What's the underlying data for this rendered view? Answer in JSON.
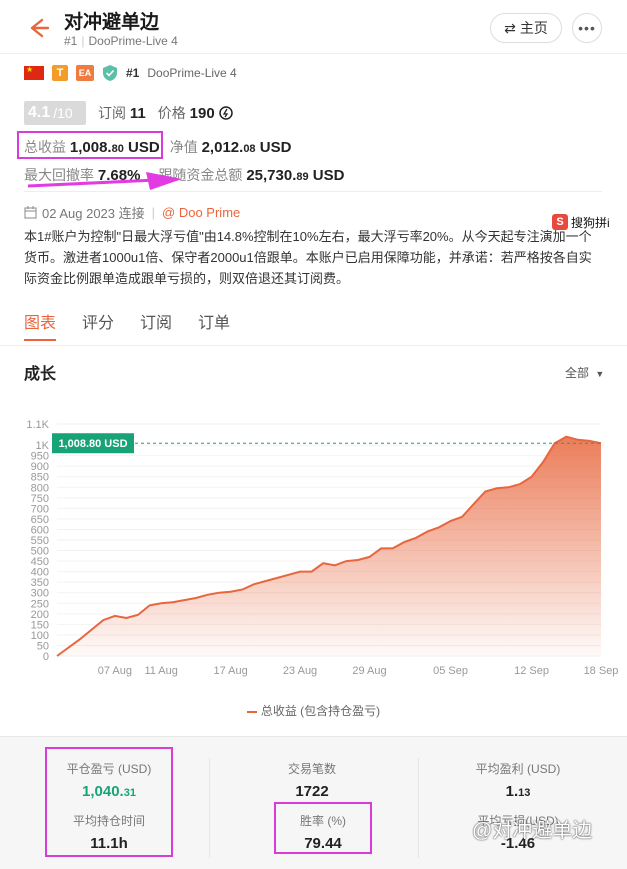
{
  "header": {
    "title": "对冲避单边",
    "rank": "#1",
    "server": "DooPrime-Live 4",
    "home_label": "主页"
  },
  "badges": {
    "t_label": "T",
    "ea_label": "EA",
    "rank": "#1",
    "server": "DooPrime-Live 4"
  },
  "rating": {
    "score": "4.1",
    "max": "/10",
    "subscribe_label": "订阅",
    "subscribe_value": "11",
    "price_label": "价格",
    "price_value": "190"
  },
  "stats": {
    "total_profit_label": "总收益",
    "total_profit_main": "1,008.",
    "total_profit_dec": "80",
    "total_profit_unit": "USD",
    "equity_label": "净值",
    "equity_main": "2,012.",
    "equity_dec": "08",
    "equity_unit": "USD",
    "drawdown_label": "最大回撤率",
    "drawdown_value": "7.68%",
    "follow_label": "跟随资金总额",
    "follow_main": "25,730.",
    "follow_dec": "89",
    "follow_unit": "USD"
  },
  "connection": {
    "date": "02 Aug 2023 连接",
    "broker": "@ Doo Prime"
  },
  "description": "本1#账户为控制\"日最大浮亏值\"由14.8%控制在10%左右，最大浮亏率20%。从今天起专注演加一个货币。激进者1000u1倍、保守者2000u1倍跟单。本账户已启用保障功能，并承诺：若严格按各自实际资金比例跟单造成跟单亏损的，则双倍退还其订阅费。",
  "sogou_label": "搜狗拼i",
  "tabs": [
    "图表",
    "评分",
    "订阅",
    "订单"
  ],
  "chart_section": {
    "title": "成长",
    "range": "全部"
  },
  "chart_data": {
    "type": "area",
    "title": "",
    "series": [
      {
        "name": "总收益 (包含持仓盈亏)",
        "x": [
          "2023-08-02",
          "2023-08-04",
          "2023-08-06",
          "2023-08-07",
          "2023-08-08",
          "2023-08-09",
          "2023-08-10",
          "2023-08-11",
          "2023-08-12",
          "2023-08-13",
          "2023-08-14",
          "2023-08-15",
          "2023-08-16",
          "2023-08-17",
          "2023-08-18",
          "2023-08-19",
          "2023-08-20",
          "2023-08-21",
          "2023-08-22",
          "2023-08-23",
          "2023-08-24",
          "2023-08-25",
          "2023-08-26",
          "2023-08-27",
          "2023-08-28",
          "2023-08-29",
          "2023-08-30",
          "2023-08-31",
          "2023-09-01",
          "2023-09-02",
          "2023-09-03",
          "2023-09-04",
          "2023-09-05",
          "2023-09-06",
          "2023-09-07",
          "2023-09-08",
          "2023-09-09",
          "2023-09-10",
          "2023-09-11",
          "2023-09-12",
          "2023-09-13",
          "2023-09-14",
          "2023-09-15",
          "2023-09-16",
          "2023-09-17",
          "2023-09-18"
        ],
        "values": [
          0,
          80,
          170,
          190,
          180,
          195,
          240,
          250,
          255,
          265,
          275,
          290,
          300,
          305,
          315,
          340,
          355,
          370,
          385,
          400,
          400,
          440,
          430,
          450,
          455,
          470,
          510,
          510,
          540,
          560,
          590,
          610,
          640,
          660,
          720,
          780,
          795,
          800,
          815,
          850,
          920,
          1008.8,
          1040,
          1025,
          1020,
          1008.8
        ]
      }
    ],
    "xticks": [
      "07 Aug",
      "11 Aug",
      "17 Aug",
      "23 Aug",
      "29 Aug",
      "05 Sep",
      "12 Sep",
      "18 Sep"
    ],
    "yticks": [
      "0",
      "50",
      "100",
      "150",
      "200",
      "250",
      "300",
      "350",
      "400",
      "450",
      "500",
      "550",
      "600",
      "650",
      "700",
      "750",
      "800",
      "850",
      "900",
      "950",
      "1K",
      "1.1K"
    ],
    "ylim": [
      0,
      1100
    ],
    "current_label": "1,008.80 USD",
    "current_value": 1008.8,
    "legend": "总收益 (包含持仓盈亏)",
    "legend_position": "bottom",
    "grid": true,
    "color": "#e8663d"
  },
  "summary": {
    "closed_pnl_label": "平仓盈亏 (USD)",
    "closed_pnl_main": "1,040.",
    "closed_pnl_dec": "31",
    "trades_label": "交易笔数",
    "trades_value": "1722",
    "avg_profit_label": "平均盈利 (USD)",
    "avg_profit_main": "1.",
    "avg_profit_dec": "13",
    "avg_hold_label": "平均持仓时间",
    "avg_hold_value": "11.1h",
    "winrate_label": "胜率 (%)",
    "winrate_value": "79.44",
    "avg_loss_label": "平均亏损(USD)",
    "avg_loss_value": "-1.46"
  },
  "watermark": "@对冲避单边",
  "colors": {
    "accent": "#e8663d",
    "green": "#17a377",
    "highlight": "#d83cd9"
  }
}
